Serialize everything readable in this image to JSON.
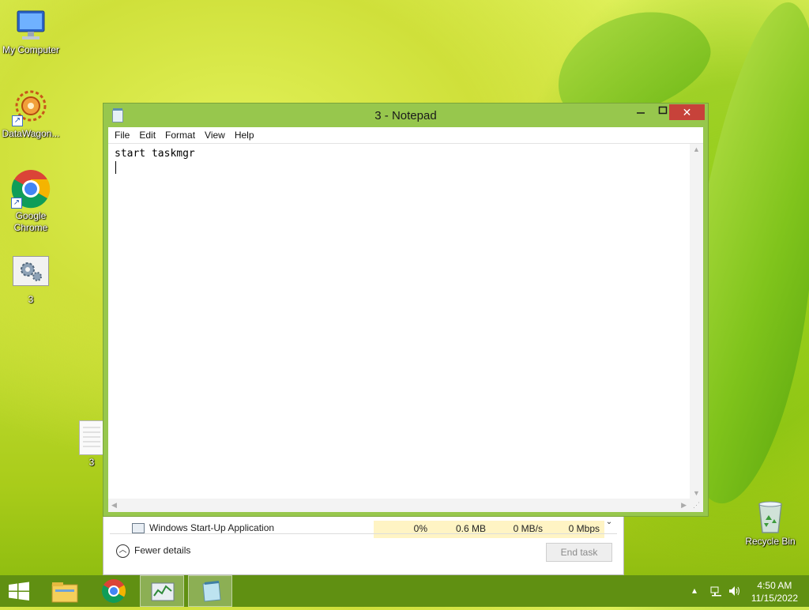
{
  "desktop": {
    "icons": [
      {
        "label": "My Computer"
      },
      {
        "label": "DataWagon..."
      },
      {
        "label": "Google Chrome"
      },
      {
        "label": "3"
      },
      {
        "label": "3"
      },
      {
        "label": "Recycle Bin"
      }
    ]
  },
  "notepad": {
    "title": "3 - Notepad",
    "menu": [
      "File",
      "Edit",
      "Format",
      "View",
      "Help"
    ],
    "content": "start taskmgr",
    "close_glyph": "✕"
  },
  "taskmanager": {
    "row": {
      "name": "Windows Start-Up Application",
      "cpu": "0%",
      "memory": "0.6 MB",
      "disk": "0 MB/s",
      "network": "0 Mbps"
    },
    "fewer_details": "Fewer details",
    "end_task": "End task"
  },
  "taskbar": {
    "time": "4:50 AM",
    "date": "11/15/2022"
  },
  "colors": {
    "window_frame": "#97c74d",
    "close_button": "#c7423a",
    "taskbar": "#5c8c12"
  }
}
